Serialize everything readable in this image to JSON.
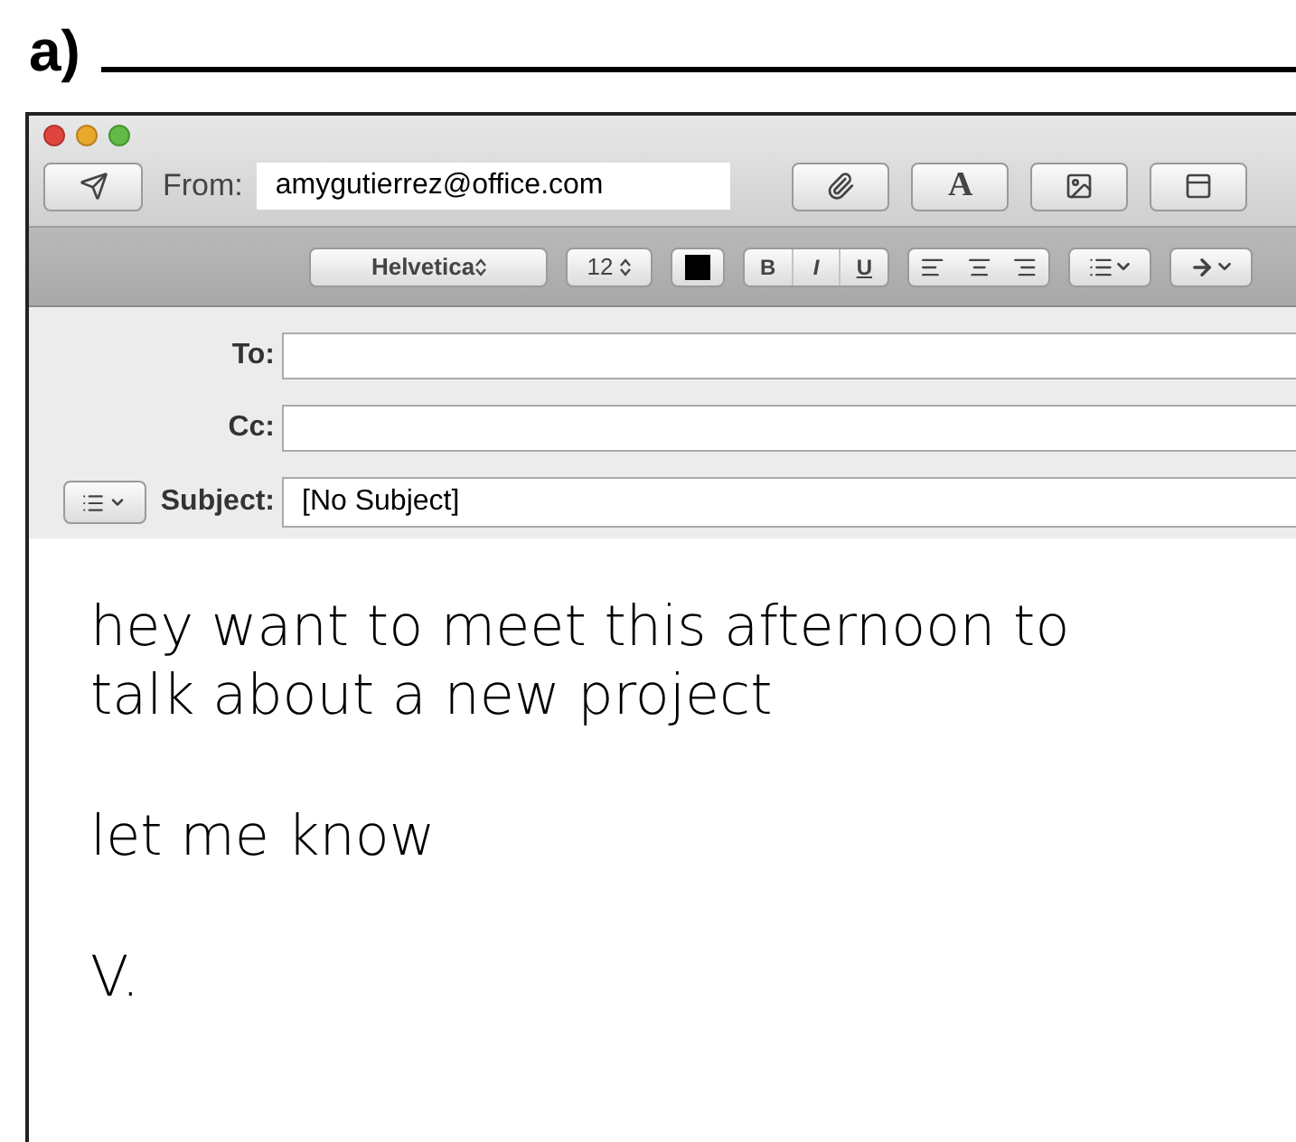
{
  "label": "a)",
  "toolbar": {
    "from_label": "From:",
    "from_value": "amygutierrez@office.com",
    "font_button": "A"
  },
  "format_bar": {
    "font": "Helvetica",
    "size": "12",
    "styles": [
      "B",
      "I",
      "U"
    ]
  },
  "fields": [
    {
      "label": "To:"
    },
    {
      "label": "Cc:"
    }
  ],
  "subject": {
    "label": "Subject:",
    "value": "[No Subject]"
  },
  "body": [
    "hey want to meet this afternoon to talk about a new project",
    "let me know",
    "V."
  ]
}
